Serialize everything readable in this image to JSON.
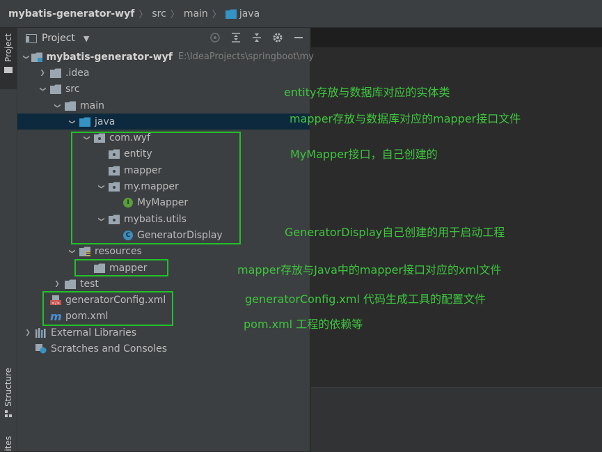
{
  "breadcrumb": [
    "mybatis-generator-wyf",
    "src",
    "main",
    "java"
  ],
  "sidebar_tabs": {
    "project": "Project",
    "structure": "Structure",
    "favorites": "ites"
  },
  "panel": {
    "title": "Project"
  },
  "tree": [
    {
      "level": 0,
      "arrow": "down",
      "icon": "module-folder",
      "label": "mybatis-generator-wyf",
      "bold": true,
      "path": "E:\\IdeaProjects\\springboot\\my"
    },
    {
      "level": 1,
      "arrow": "right",
      "icon": "folder",
      "label": ".idea"
    },
    {
      "level": 1,
      "arrow": "down",
      "icon": "folder",
      "label": "src"
    },
    {
      "level": 2,
      "arrow": "down",
      "icon": "folder",
      "label": "main"
    },
    {
      "level": 3,
      "arrow": "down",
      "icon": "source-folder",
      "label": "java",
      "selected": true
    },
    {
      "level": 4,
      "arrow": "down",
      "icon": "package",
      "label": "com.wyf"
    },
    {
      "level": 5,
      "arrow": "none",
      "icon": "package",
      "label": "entity"
    },
    {
      "level": 5,
      "arrow": "none",
      "icon": "package",
      "label": "mapper"
    },
    {
      "level": 5,
      "arrow": "down",
      "icon": "package",
      "label": "my.mapper"
    },
    {
      "level": 6,
      "arrow": "none",
      "icon": "interface",
      "label": "MyMapper"
    },
    {
      "level": 5,
      "arrow": "down",
      "icon": "package",
      "label": "mybatis.utils"
    },
    {
      "level": 6,
      "arrow": "none",
      "icon": "class",
      "label": "GeneratorDisplay"
    },
    {
      "level": 3,
      "arrow": "down",
      "icon": "resources-folder",
      "label": "resources"
    },
    {
      "level": 4,
      "arrow": "none",
      "icon": "folder",
      "label": "mapper"
    },
    {
      "level": 2,
      "arrow": "right",
      "icon": "folder",
      "label": "test"
    },
    {
      "level": 1,
      "arrow": "none",
      "icon": "xml",
      "label": "generatorConfig.xml"
    },
    {
      "level": 1,
      "arrow": "none",
      "icon": "maven",
      "label": "pom.xml"
    },
    {
      "level": 0,
      "arrow": "right",
      "icon": "libraries",
      "label": "External Libraries"
    },
    {
      "level": 0,
      "arrow": "none",
      "icon": "scratches",
      "label": "Scratches and Consoles"
    }
  ],
  "annotations": [
    "entity存放与数据库对应的实体类",
    "mapper存放与数据库对应的mapper接口文件",
    "MyMapper接口，自己创建的",
    "GeneratorDisplay自己创建的用于启动工程",
    "mapper存放与Java中的mapper接口对应的xml文件",
    "generatorConfig.xml 代码生成工具的配置文件",
    "pom.xml 工程的依赖等"
  ],
  "colors": {
    "annotation": "#3ec53e",
    "box": "#22c02a",
    "selected_row": "#0d293e",
    "panel_bg": "#3c3f41"
  },
  "icons": {
    "settings": "gear-icon",
    "hide": "minus-icon",
    "target": "locate-icon",
    "expand": "expand-all-icon",
    "collapse": "collapse-all-icon"
  }
}
